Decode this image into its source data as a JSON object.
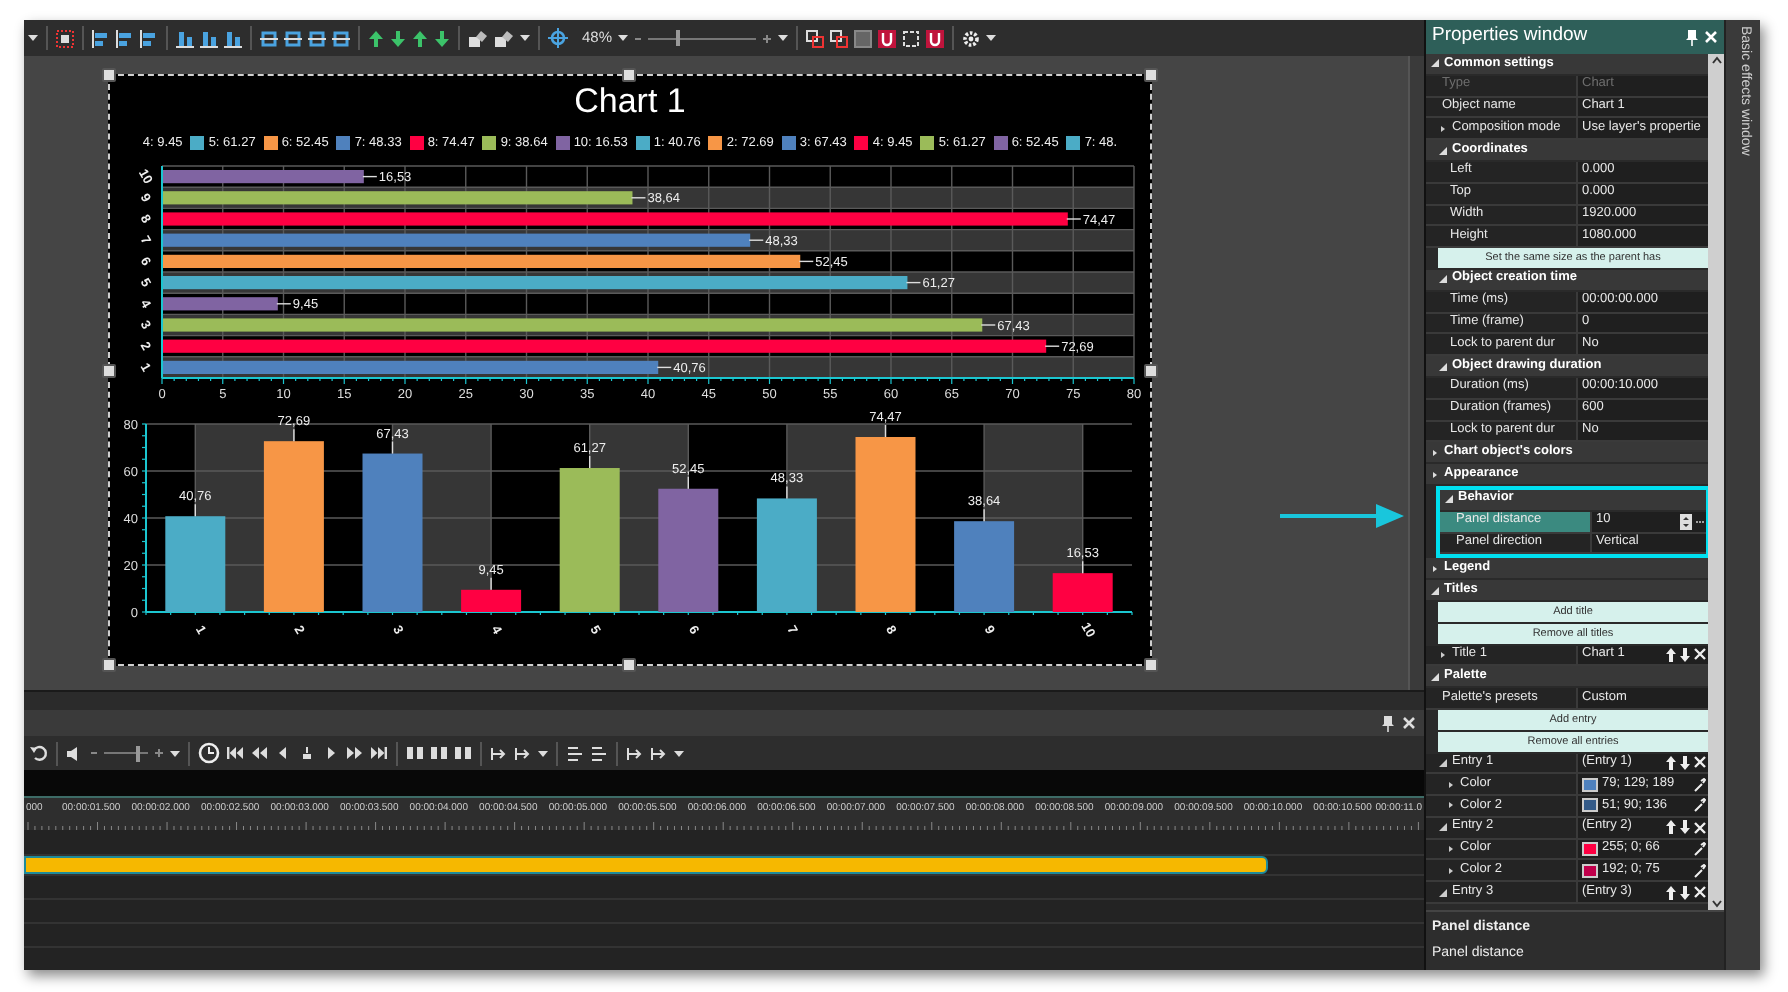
{
  "toolbar": {
    "zoom": "48%",
    "zoom_slider": {
      "level": 0.28
    }
  },
  "chart": {
    "title": "Chart 1",
    "legend": [
      {
        "label": "4: 9.45"
      },
      {
        "label": "5: 61.27",
        "color": "#4bacc6"
      },
      {
        "label": "6: 52.45",
        "color": "#f79646"
      },
      {
        "label": "7: 48.33",
        "color": "#4f81bd"
      },
      {
        "label": "8: 74.47",
        "color": "#ff0042"
      },
      {
        "label": "9: 38.64",
        "color": "#9bbb59"
      },
      {
        "label": "10: 16.53",
        "color": "#8064a2"
      },
      {
        "label": "1: 40.76",
        "color": "#4bacc6"
      },
      {
        "label": "2: 72.69",
        "color": "#f79646"
      },
      {
        "label": "3: 67.43",
        "color": "#4f81bd"
      },
      {
        "label": "4: 9.45",
        "color": "#ff0042"
      },
      {
        "label": "5: 61.27",
        "color": "#9bbb59"
      },
      {
        "label": "6: 52.45",
        "color": "#8064a2"
      },
      {
        "label": "7: 48.",
        "color": "#4bacc6"
      }
    ],
    "charts": [
      {
        "chart_data": {
          "type": "bar",
          "orientation": "horizontal",
          "grid": true,
          "categories": [
            "10",
            "9",
            "8",
            "7",
            "6",
            "5",
            "4",
            "3",
            "2",
            "1"
          ],
          "series": [
            {
              "color": "#8064a2",
              "values": [
                16.53,
                null,
                null,
                null,
                null,
                null,
                9.45,
                null,
                null,
                null
              ]
            },
            {
              "color": "#9bbb59",
              "values": [
                null,
                38.64,
                null,
                null,
                null,
                null,
                null,
                67.43,
                null,
                null
              ]
            },
            {
              "color": "#ff0042",
              "values": [
                null,
                null,
                74.47,
                null,
                null,
                null,
                null,
                null,
                72.69,
                null
              ]
            },
            {
              "color": "#4f81bd",
              "values": [
                null,
                null,
                null,
                48.33,
                null,
                null,
                null,
                null,
                null,
                40.76
              ]
            },
            {
              "color": "#f79646",
              "values": [
                null,
                null,
                null,
                null,
                52.45,
                null,
                null,
                null,
                null,
                null
              ]
            },
            {
              "color": "#4bacc6",
              "values": [
                null,
                null,
                null,
                null,
                null,
                61.27,
                null,
                null,
                null,
                null
              ]
            }
          ],
          "value_labels": [
            "16,53",
            "38,64",
            "74,47",
            "48,33",
            "52,45",
            "61,27",
            "9,45",
            "67,43",
            "72,69",
            "40,76"
          ],
          "xlim": [
            0,
            80
          ],
          "xticks": [
            0,
            5,
            10,
            15,
            20,
            25,
            30,
            35,
            40,
            45,
            50,
            55,
            60,
            65,
            70,
            75,
            80
          ]
        }
      },
      {
        "chart_data": {
          "type": "bar",
          "orientation": "vertical",
          "grid": true,
          "categories": [
            "1",
            "2",
            "3",
            "4",
            "5",
            "6",
            "7",
            "8",
            "9",
            "10"
          ],
          "series": [
            {
              "color": "#4bacc6",
              "values": [
                40.76,
                null,
                null,
                null,
                null,
                null,
                48.33,
                null,
                null,
                null
              ]
            },
            {
              "color": "#f79646",
              "values": [
                null,
                72.69,
                null,
                null,
                null,
                null,
                null,
                74.47,
                null,
                null
              ]
            },
            {
              "color": "#4f81bd",
              "values": [
                null,
                null,
                67.43,
                null,
                null,
                null,
                null,
                null,
                38.64,
                null
              ]
            },
            {
              "color": "#ff0042",
              "values": [
                null,
                null,
                null,
                9.45,
                null,
                null,
                null,
                null,
                null,
                16.53
              ]
            },
            {
              "color": "#9bbb59",
              "values": [
                null,
                null,
                null,
                null,
                61.27,
                null,
                null,
                null,
                null,
                null
              ]
            },
            {
              "color": "#8064a2",
              "values": [
                null,
                null,
                null,
                null,
                null,
                52.45,
                null,
                null,
                null,
                null
              ]
            }
          ],
          "value_labels": [
            "40,76",
            "72,69",
            "67,43",
            "9,45",
            "61,27",
            "52,45",
            "48,33",
            "74,47",
            "38,64",
            "16,53"
          ],
          "bands": [
            {
              "axis": "x",
              "from": "1",
              "to": "2",
              "color": "#363636"
            },
            {
              "axis": "x",
              "from": "3",
              "to": "4",
              "color": "#363636"
            },
            {
              "axis": "x",
              "from": "5",
              "to": "6",
              "color": "#363636"
            },
            {
              "axis": "x",
              "from": "7",
              "to": "8",
              "color": "#363636"
            },
            {
              "axis": "x",
              "from": "9",
              "to": "10",
              "color": "#363636"
            }
          ],
          "ylim": [
            0,
            80
          ],
          "yticks": [
            0,
            20,
            40,
            60,
            80
          ]
        }
      }
    ]
  },
  "timeline": {
    "volume_slider": {
      "level": 0.77
    },
    "ruler": [
      "000",
      "00:00:01.500",
      "00:00:02.000",
      "00:00:02.500",
      "00:00:03.000",
      "00:00:03.500",
      "00:00:04.000",
      "00:00:04.500",
      "00:00:05.000",
      "00:00:05.500",
      "00:00:06.000",
      "00:00:06.500",
      "00:00:07.000",
      "00:00:07.500",
      "00:00:08.000",
      "00:00:08.500",
      "00:00:09.000",
      "00:00:09.500",
      "00:00:10.000",
      "00:00:10.500",
      "00:00:11.0"
    ]
  },
  "properties": {
    "title": "Properties window",
    "items": [
      {
        "kind": "group",
        "label": "Common settings",
        "expanded": true,
        "children": [
          {
            "kind": "property",
            "name": "Type",
            "value": "Chart",
            "disabled": true,
            "selected": false
          },
          {
            "kind": "property",
            "name": "Object name",
            "value": "Chart 1",
            "selected": false
          },
          {
            "kind": "property",
            "name": "Composition mode",
            "value": "Use layer's propertie",
            "expanded": false,
            "selected": false
          },
          {
            "kind": "group",
            "label": "Coordinates",
            "expanded": true,
            "children": [
              {
                "kind": "property",
                "name": "Left",
                "value": "0.000",
                "selected": false
              },
              {
                "kind": "property",
                "name": "Top",
                "value": "0.000",
                "selected": false
              },
              {
                "kind": "property",
                "name": "Width",
                "value": "1920.000",
                "selected": false
              },
              {
                "kind": "property",
                "name": "Height",
                "value": "1080.000",
                "selected": false
              }
            ]
          },
          {
            "kind": "button",
            "label": "Set the same size as the parent has"
          },
          {
            "kind": "group",
            "label": "Object creation time",
            "expanded": true,
            "children": [
              {
                "kind": "property",
                "name": "Time (ms)",
                "value": "00:00:00.000",
                "selected": false
              },
              {
                "kind": "property",
                "name": "Time (frame)",
                "value": "0",
                "selected": false
              },
              {
                "kind": "property",
                "name": "Lock to parent dur",
                "value": "No",
                "selected": false
              }
            ]
          },
          {
            "kind": "group",
            "label": "Object drawing duration",
            "expanded": true,
            "children": [
              {
                "kind": "property",
                "name": "Duration (ms)",
                "value": "00:00:10.000",
                "selected": false
              },
              {
                "kind": "property",
                "name": "Duration (frames)",
                "value": "600",
                "selected": false
              },
              {
                "kind": "property",
                "name": "Lock to parent dur",
                "value": "No",
                "selected": false
              }
            ]
          }
        ]
      },
      {
        "kind": "group",
        "label": "Chart object's colors",
        "expanded": false
      },
      {
        "kind": "group",
        "label": "Appearance",
        "expanded": false
      },
      {
        "kind": "group",
        "label": "Behavior",
        "expanded": true,
        "highlighted": true,
        "children": [
          {
            "kind": "property",
            "name": "Panel distance",
            "value": "10",
            "selected": true,
            "spinner": true
          },
          {
            "kind": "property",
            "name": "Panel direction",
            "value": "Vertical",
            "selected": false
          }
        ]
      },
      {
        "kind": "group",
        "label": "Legend",
        "expanded": false
      },
      {
        "kind": "group",
        "label": "Titles",
        "expanded": true,
        "children": [
          {
            "kind": "button",
            "label": "Add title"
          },
          {
            "kind": "button",
            "label": "Remove all titles"
          },
          {
            "kind": "property",
            "name": "Title 1",
            "value": "Chart 1",
            "expanded": false,
            "actions": true,
            "selected": false
          }
        ]
      },
      {
        "kind": "group",
        "label": "Palette",
        "expanded": true,
        "children": [
          {
            "kind": "property",
            "name": "Palette's presets",
            "value": "Custom",
            "selected": false
          },
          {
            "kind": "button",
            "label": "Add entry"
          },
          {
            "kind": "button",
            "label": "Remove all entries"
          },
          {
            "kind": "property",
            "name": "Entry 1",
            "value": "(Entry 1)",
            "expanded": true,
            "actions": true,
            "selected": false,
            "children": [
              {
                "kind": "property",
                "name": "Color",
                "value": "79; 129; 189",
                "color": "#4f81bd",
                "expanded": false,
                "picker": true,
                "selected": false
              },
              {
                "kind": "property",
                "name": "Color 2",
                "value": "51; 90; 136",
                "color": "#335a88",
                "expanded": false,
                "picker": true,
                "selected": false
              }
            ]
          },
          {
            "kind": "property",
            "name": "Entry 2",
            "value": "(Entry 2)",
            "expanded": true,
            "actions": true,
            "selected": false,
            "children": [
              {
                "kind": "property",
                "name": "Color",
                "value": "255; 0; 66",
                "color": "#ff0042",
                "expanded": false,
                "picker": true,
                "selected": false
              },
              {
                "kind": "property",
                "name": "Color 2",
                "value": "192; 0; 75",
                "color": "#c0004b",
                "expanded": false,
                "picker": true,
                "selected": false
              }
            ]
          },
          {
            "kind": "property",
            "name": "Entry 3",
            "value": "(Entry 3)",
            "expanded": true,
            "actions": true,
            "selected": false
          }
        ]
      }
    ],
    "description": {
      "title": "Panel distance",
      "text": "Panel distance"
    }
  },
  "side_tab": "Basic effects window"
}
